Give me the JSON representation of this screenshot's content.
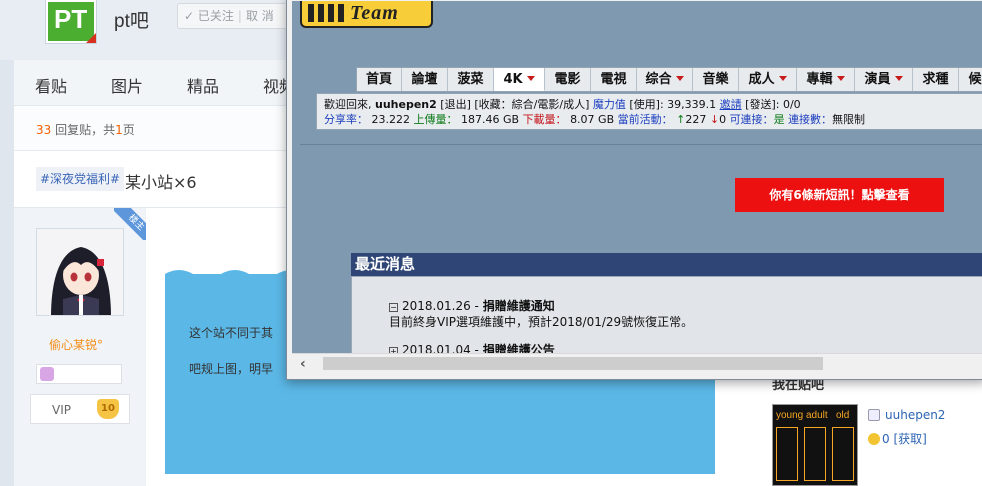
{
  "tieba": {
    "logo_text": "PT",
    "forum_name": "pt吧",
    "follow_label": "已关注",
    "unfollow_label": "取 消",
    "tabs": [
      "看贴",
      "图片",
      "精品",
      "视频"
    ],
    "pager": {
      "count": "33",
      "label_a": " 回复贴，共",
      "pages": "1",
      "label_b": "页"
    },
    "post_tag": "#深夜党福利#",
    "post_title": "某小站×6",
    "badge": "楼主",
    "username": "偷心某锐°",
    "vip_label": "VIP",
    "vip_level": "10",
    "content_lines": [
      "这个站不同于其",
      "吧规上图，明早"
    ],
    "right_heading": "我在贴吧",
    "right_user": "uuhepen2",
    "right_coins": "0",
    "right_get": "[获取]",
    "cover_words": [
      "young",
      "adult",
      "old"
    ]
  },
  "window": {
    "logo_text": "Team",
    "nav": [
      {
        "label": "首頁",
        "caret": false,
        "active": false
      },
      {
        "label": "論壇",
        "caret": false,
        "active": false
      },
      {
        "label": "菠菜",
        "caret": false,
        "active": false
      },
      {
        "label": "4K",
        "caret": true,
        "active": true
      },
      {
        "label": "電影",
        "caret": false,
        "active": false
      },
      {
        "label": "電視",
        "caret": false,
        "active": false
      },
      {
        "label": "综合",
        "caret": true,
        "active": false
      },
      {
        "label": "音樂",
        "caret": false,
        "active": false
      },
      {
        "label": "成人",
        "caret": true,
        "active": false
      },
      {
        "label": "專輯",
        "caret": true,
        "active": false
      },
      {
        "label": "演員",
        "caret": true,
        "active": false
      },
      {
        "label": "求種",
        "caret": false,
        "active": false
      },
      {
        "label": "候選",
        "caret": false,
        "active": false
      }
    ],
    "info": {
      "welcome": "歡迎回來,",
      "user": "uuhepen2",
      "logout": "[退出]",
      "fav": "[收藏：綜合/電影/成人]",
      "magic_label": "魔力值",
      "magic_use": "[使用]:",
      "magic_value": "39,339.1",
      "invite": "邀請",
      "send": "[發送]:",
      "send_value": "0/0",
      "ratio_label": "分享率：",
      "ratio_value": "23.222",
      "up_label": "上傳量：",
      "up_value": "187.46 GB",
      "down_label": "下載量：",
      "down_value": "8.07 GB",
      "active_label": "當前活動：",
      "seeding": "227",
      "leeching": "0",
      "connectable_label": "可連接：",
      "connectable_value": "是",
      "conn_label": "連接數：",
      "conn_value": "無限制"
    },
    "message_button": "你有6條新短訊！點擊查看",
    "news_heading": "最近消息",
    "news": [
      {
        "toggle": "−",
        "date": "2018.01.26",
        "title": "捐贈維護通知",
        "desc": "目前終身VIP選項維護中，預計2018/01/29號恢復正常。"
      },
      {
        "toggle": "+",
        "date": "2018.01.04",
        "title": "捐贈維護公告",
        "desc": ""
      }
    ]
  },
  "colors": {
    "tieba_green": "#4cae30",
    "site_bg": "#7f99b0",
    "news_header": "#2e4575",
    "alert_red": "#ec1010"
  }
}
